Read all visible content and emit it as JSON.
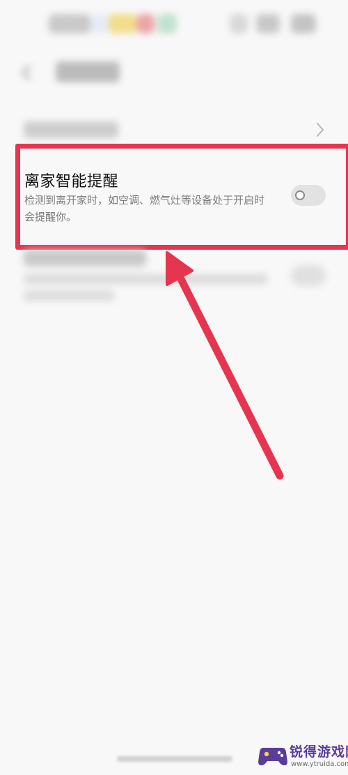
{
  "setting_item": {
    "title": "离家智能提醒",
    "description": "检测到离开家时，如空调、燃气灶等设备处于开启时会提醒你。",
    "toggle_state": "off"
  },
  "icons": {
    "back": "back-arrow-icon",
    "chevron": "chevron-right-icon",
    "toggle": "toggle-switch-icon"
  },
  "colors": {
    "highlight": "#e6354f",
    "background": "#f8f8f9",
    "watermark_purple": "#5a3d9a"
  },
  "watermark": {
    "title": "锐得游戏网",
    "url": "www.ytruida.com"
  }
}
